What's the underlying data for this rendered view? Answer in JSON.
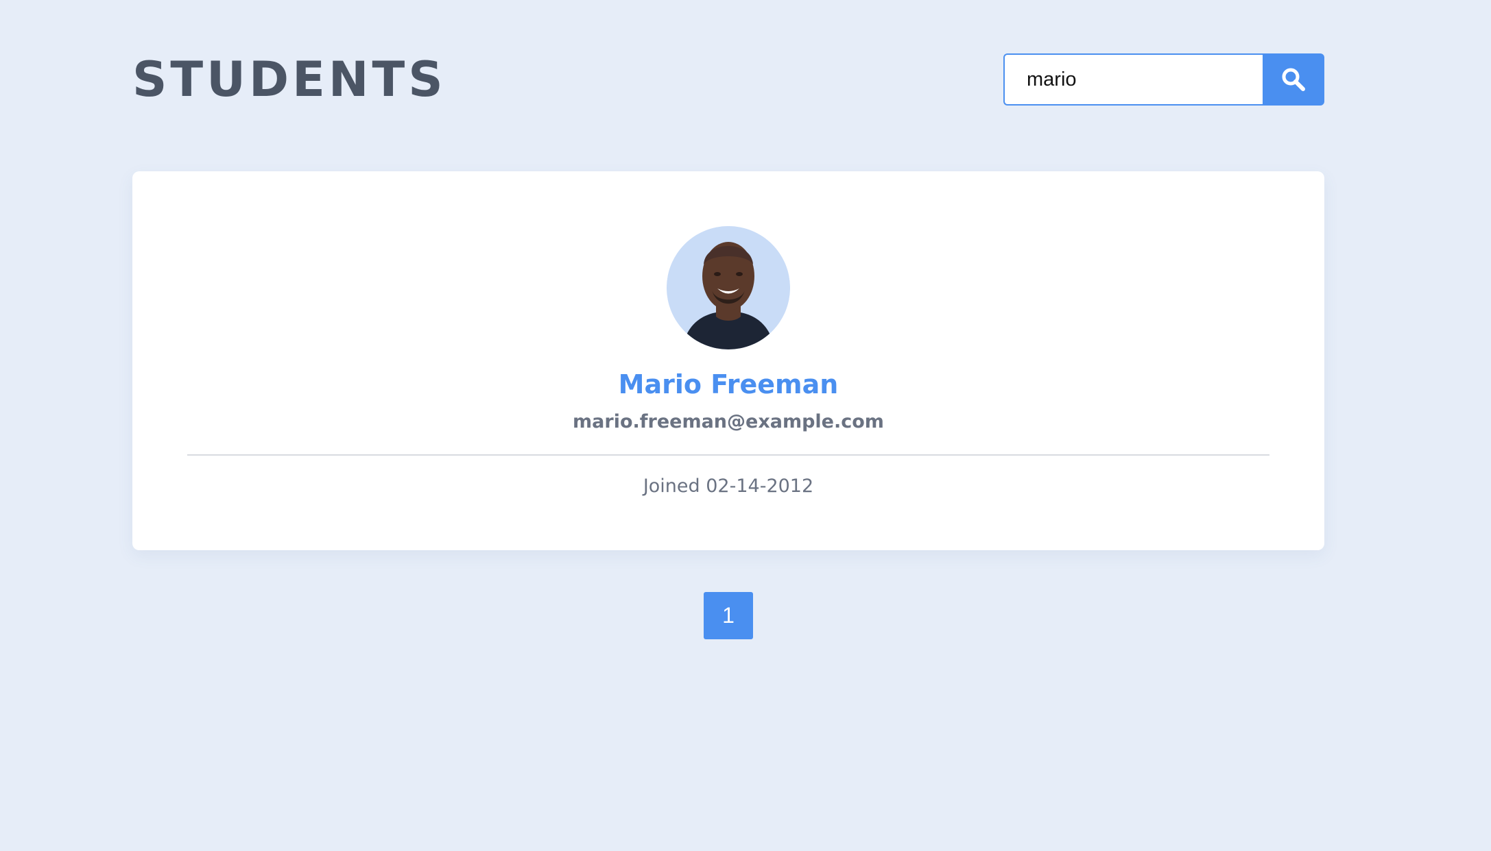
{
  "header": {
    "title": "STUDENTS"
  },
  "search": {
    "value": "mario",
    "icon": "search-icon"
  },
  "student": {
    "name": "Mario Freeman",
    "email": "mario.freeman@example.com",
    "joined": "Joined 02-14-2012",
    "avatar": "avatar-photo"
  },
  "pagination": {
    "pages": [
      "1"
    ],
    "current": "1"
  },
  "colors": {
    "background": "#e6edf8",
    "accent": "#4a8ff0",
    "title": "#4b5565",
    "muted": "#6a7282"
  }
}
